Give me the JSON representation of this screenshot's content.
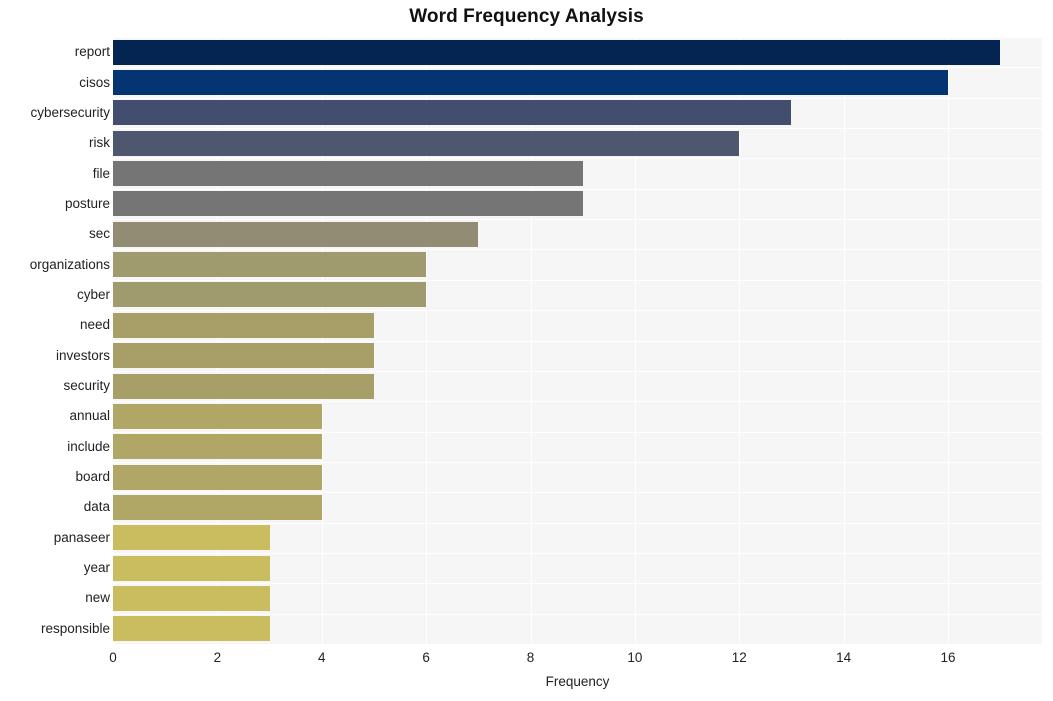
{
  "chart_data": {
    "type": "bar",
    "orientation": "horizontal",
    "title": "Word Frequency Analysis",
    "xlabel": "Frequency",
    "ylabel": "",
    "xlim": [
      0,
      17.8
    ],
    "xticks": [
      0,
      2,
      4,
      6,
      8,
      10,
      12,
      14,
      16
    ],
    "grid": true,
    "legend": null,
    "categories": [
      "report",
      "cisos",
      "cybersecurity",
      "risk",
      "file",
      "posture",
      "sec",
      "organizations",
      "cyber",
      "need",
      "investors",
      "security",
      "annual",
      "include",
      "board",
      "data",
      "panaseer",
      "year",
      "new",
      "responsible"
    ],
    "values": [
      17,
      16,
      13,
      12,
      9,
      9,
      7,
      6,
      6,
      5,
      5,
      5,
      4,
      4,
      4,
      4,
      3,
      3,
      3,
      3
    ],
    "colors": [
      "#042452",
      "#043572",
      "#434d6e",
      "#4f576e",
      "#757575",
      "#757575",
      "#928c75",
      "#a09a6f",
      "#a09a6f",
      "#a89f68",
      "#a89f68",
      "#a89f68",
      "#b0a766",
      "#b0a766",
      "#b0a766",
      "#b0a766",
      "#c9bd5f",
      "#c9bd5f",
      "#c9bd5f",
      "#c9bd5f"
    ],
    "plot_background": "#f6f6f6",
    "grid_color": "#ffffff",
    "figure_background": "#ffffff"
  }
}
